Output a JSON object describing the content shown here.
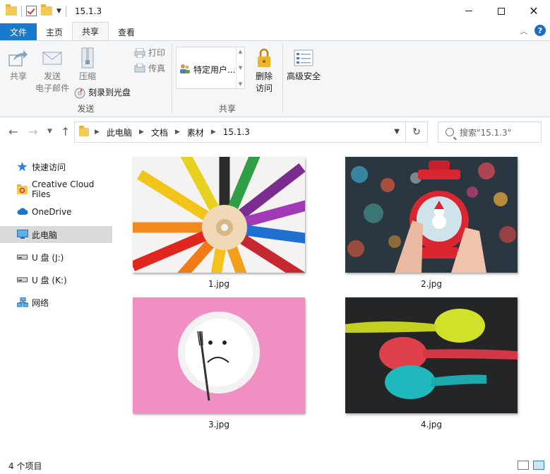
{
  "window": {
    "title": "15.1.3"
  },
  "tabs": [
    {
      "label": "文件",
      "key": "file"
    },
    {
      "label": "主页",
      "key": "home"
    },
    {
      "label": "共享",
      "key": "share"
    },
    {
      "label": "查看",
      "key": "view"
    }
  ],
  "ribbon": {
    "send_group": {
      "label": "发送",
      "share_label": "共享",
      "email_label_1": "发送",
      "email_label_2": "电子邮件",
      "zip_label": "压缩",
      "print_label": "打印",
      "fax_label": "传真",
      "burn_label": "刻录到光盘"
    },
    "share_group": {
      "label": "共享",
      "specific_user": "特定用户...",
      "remove_access_1": "删除",
      "remove_access_2": "访问",
      "advanced_security": "高级安全"
    }
  },
  "address": {
    "crumbs": [
      "此电脑",
      "文档",
      "素材",
      "15.1.3"
    ],
    "search_placeholder": "搜索\"15.1.3\""
  },
  "sidebar": {
    "items": [
      {
        "label": "快速访问",
        "icon": "star-icon"
      },
      {
        "label": "Creative Cloud Files",
        "icon": "creative-cloud-folder-icon"
      },
      {
        "label": "OneDrive",
        "icon": "cloud-icon"
      },
      {
        "label": "此电脑",
        "icon": "computer-icon",
        "selected": true
      },
      {
        "label": "U 盘 (J:)",
        "icon": "usb-drive-icon"
      },
      {
        "label": "U 盘 (K:)",
        "icon": "usb-drive-icon"
      },
      {
        "label": "网络",
        "icon": "network-icon"
      }
    ]
  },
  "files": [
    {
      "name": "1.jpg",
      "depicts": "colored pencils radiating in a circle"
    },
    {
      "name": "2.jpg",
      "depicts": "hand holding a red snow globe lantern with bokeh lights"
    },
    {
      "name": "3.jpg",
      "depicts": "white plate with sad face and fork on pink background"
    },
    {
      "name": "4.jpg",
      "depicts": "yellow, red and teal spoons on dark background"
    }
  ],
  "status": {
    "item_count": "4 个项目"
  }
}
